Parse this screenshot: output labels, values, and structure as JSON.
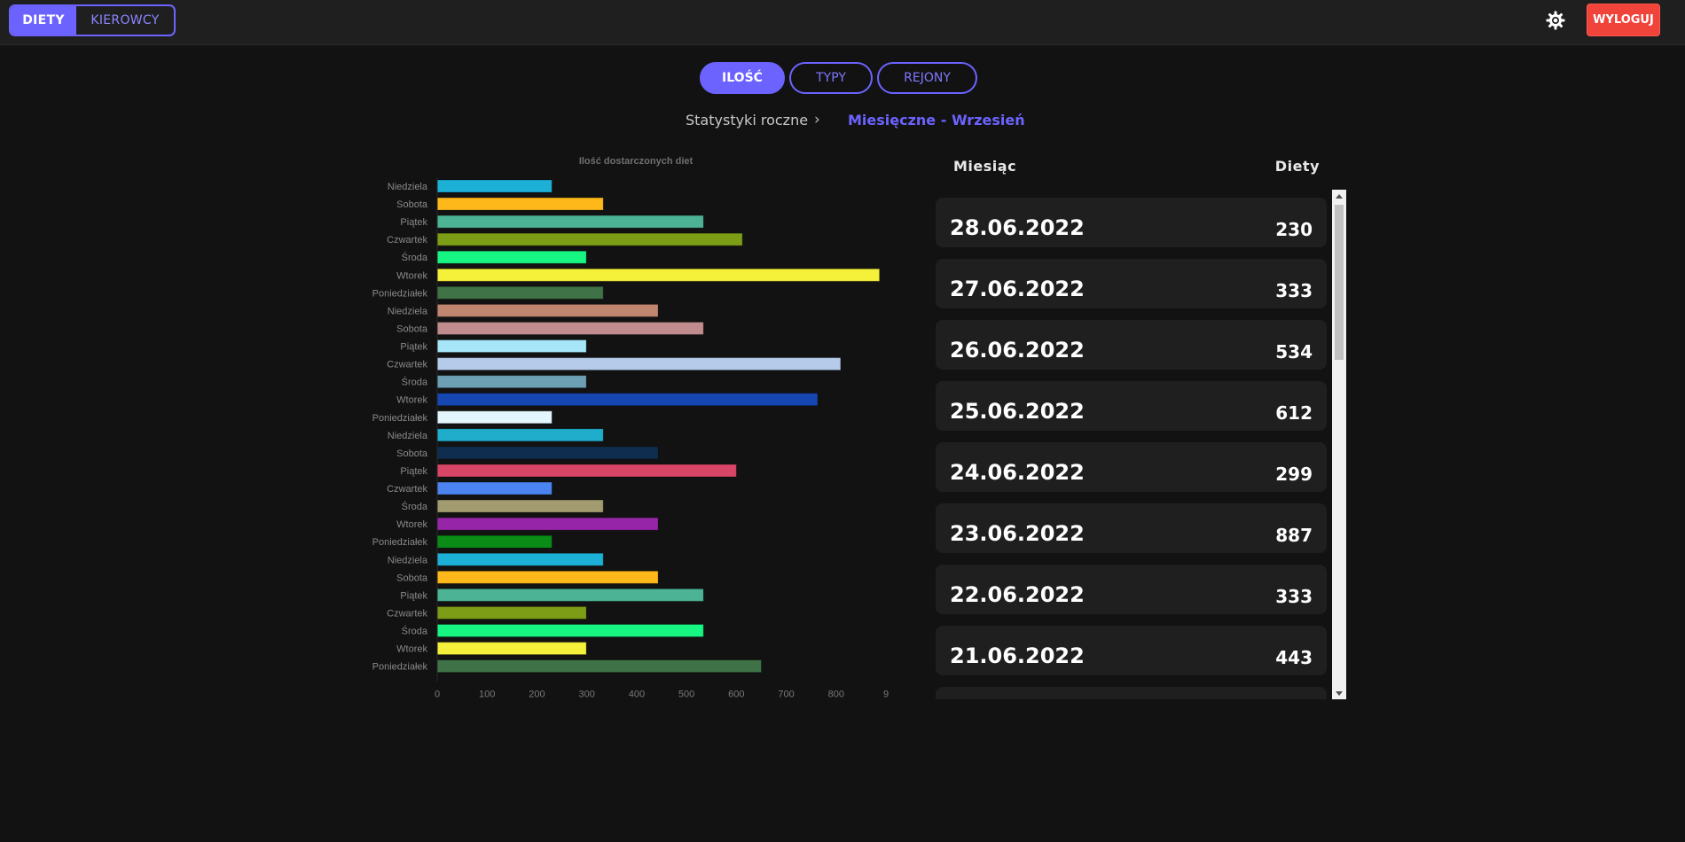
{
  "topbar": {
    "segments": [
      {
        "label": "DIETY",
        "active": true
      },
      {
        "label": "KIEROWCY",
        "active": false
      }
    ],
    "settings_icon": "gear-icon",
    "logout_label": "WYLOGUJ"
  },
  "tabs": [
    {
      "label": "ILOŚĆ",
      "active": true
    },
    {
      "label": "TYPY",
      "active": false
    },
    {
      "label": "REJONY",
      "active": false
    }
  ],
  "breadcrumb": {
    "item1": "Statystyki roczne",
    "item2": "Miesięczne - Wrzesień"
  },
  "colors": {
    "accent": "#6c63ff",
    "logout": "#f0433a",
    "background": "#121212"
  },
  "chart_data": {
    "type": "bar",
    "orientation": "horizontal",
    "title": "Ilość dostarczonych diet",
    "categories": [
      "Niedziela",
      "Sobota",
      "Piątek",
      "Czwartek",
      "Środa",
      "Wtorek",
      "Poniedziałek",
      "Niedziela",
      "Sobota",
      "Piątek",
      "Czwartek",
      "Środa",
      "Wtorek",
      "Poniedziałek",
      "Niedziela",
      "Sobota",
      "Piątek",
      "Czwartek",
      "Środa",
      "Wtorek",
      "Poniedziałek",
      "Niedziela",
      "Sobota",
      "Piątek",
      "Czwartek",
      "Środa",
      "Wtorek",
      "Poniedziałek"
    ],
    "values": [
      230,
      333,
      534,
      612,
      299,
      887,
      333,
      443,
      534,
      299,
      809,
      299,
      763,
      230,
      333,
      443,
      600,
      230,
      333,
      443,
      230,
      333,
      443,
      534,
      299,
      534,
      299,
      650
    ],
    "colors": [
      "#1cb0d6",
      "#ffb81a",
      "#4db395",
      "#7c9d15",
      "#17f583",
      "#f5f03a",
      "#3f7347",
      "#c0866f",
      "#c18c8e",
      "#a6e6f8",
      "#b5cbe9",
      "#6c9fb4",
      "#1646b0",
      "#e4f6fd",
      "#1fadcb",
      "#0f2e4f",
      "#d74567",
      "#4b84f0",
      "#a29b6f",
      "#9625a7",
      "#0a8c17",
      "#1cb0d6",
      "#ffb81a",
      "#4db395",
      "#7c9d15",
      "#17f583",
      "#f5f03a",
      "#3f7347"
    ],
    "xticks": [
      "0",
      "100",
      "200",
      "300",
      "400",
      "500",
      "600",
      "700",
      "800",
      "9"
    ],
    "xlim": [
      0,
      900
    ],
    "grid": false,
    "legend": "none"
  },
  "table": {
    "col_date": "Miesiąc",
    "col_value": "Diety",
    "rows": [
      {
        "date": "28.06.2022",
        "value": "230"
      },
      {
        "date": "27.06.2022",
        "value": "333"
      },
      {
        "date": "26.06.2022",
        "value": "534"
      },
      {
        "date": "25.06.2022",
        "value": "612"
      },
      {
        "date": "24.06.2022",
        "value": "299"
      },
      {
        "date": "23.06.2022",
        "value": "887"
      },
      {
        "date": "22.06.2022",
        "value": "333"
      },
      {
        "date": "21.06.2022",
        "value": "443"
      },
      {
        "date": "",
        "value": ""
      }
    ]
  }
}
